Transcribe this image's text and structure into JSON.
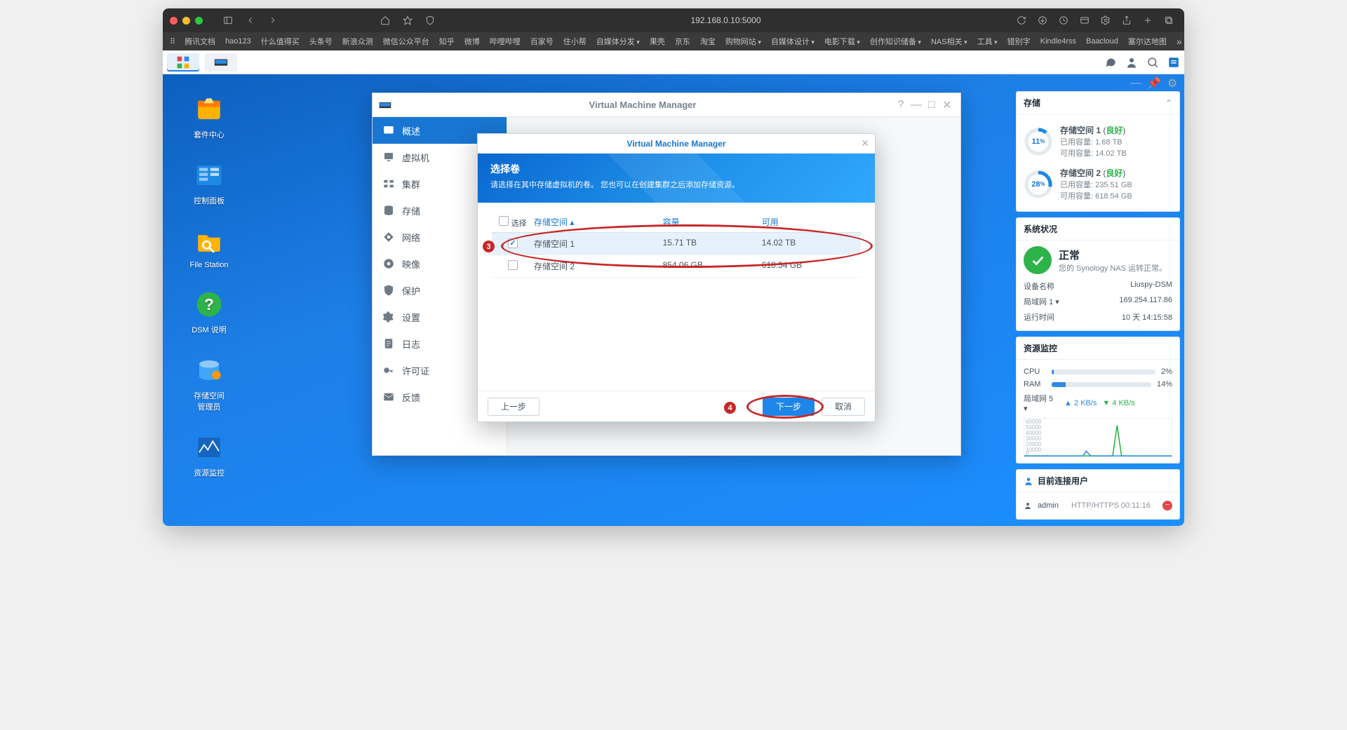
{
  "browser": {
    "address": "192.168.0.10:5000",
    "bookmarks": [
      "腾讯文档",
      "hao123",
      "什么值得买",
      "头条号",
      "新浪众测",
      "微信公众平台",
      "知乎",
      "微博",
      "哔哩哔哩",
      "百家号",
      "住小帮",
      "自媒体分发",
      "果壳",
      "京东",
      "淘宝",
      "购物网站",
      "自媒体设计",
      "电影下载",
      "创作知识储备",
      "NAS相关",
      "工具",
      "错别字",
      "Kindle4rss",
      "Baacloud",
      "塞尔达地图"
    ],
    "bookmark_dropdown_indices": [
      11,
      15,
      16,
      17,
      18,
      19,
      20
    ]
  },
  "desktop_icons": [
    {
      "label": "套件中心",
      "color": "#ff9a00"
    },
    {
      "label": "控制面板",
      "color": "#2b8ae6"
    },
    {
      "label": "File Station",
      "color": "#f7b500"
    },
    {
      "label": "DSM 说明",
      "color": "#1aa33a"
    },
    {
      "label": "存储空间\n管理员",
      "color": "#2b8ae6"
    },
    {
      "label": "资源监控",
      "color": "#245aa6"
    }
  ],
  "widgets": {
    "storage": {
      "title": "存储",
      "volumes": [
        {
          "name": "存储空间 1",
          "status": "良好",
          "used_label": "已用容量: 1.68 TB",
          "avail_label": "可用容量: 14.02 TB",
          "pct": 11
        },
        {
          "name": "存储空间 2",
          "status": "良好",
          "used_label": "已用容量: 235.51 GB",
          "avail_label": "可用容量: 618.54 GB",
          "pct": 28
        }
      ]
    },
    "health": {
      "title": "系统状况",
      "status": "正常",
      "detail": "您的 Synology NAS 运转正常。",
      "rows": [
        [
          "设备名称",
          "Liuspy-DSM"
        ],
        [
          "局域网 1",
          "169.254.117.86"
        ],
        [
          "运行时间",
          "10 天 14:15:58"
        ]
      ]
    },
    "resource": {
      "title": "资源监控",
      "cpu": {
        "label": "CPU",
        "pct": 2
      },
      "ram": {
        "label": "RAM",
        "pct": 14
      },
      "net": {
        "label": "局域网 5",
        "up": "2 KB/s",
        "down": "4 KB/s"
      },
      "ylabels": [
        "60000",
        "50000",
        "40000",
        "30000",
        "20000",
        "10000",
        "0"
      ]
    },
    "users": {
      "title": "目前连接用户",
      "rows": [
        {
          "name": "admin",
          "proto": "HTTP/HTTPS 00:11:16"
        }
      ]
    }
  },
  "vmm": {
    "title": "Virtual Machine Manager",
    "nav": [
      "概述",
      "虚拟机",
      "集群",
      "存储",
      "网络",
      "映像",
      "保护",
      "设置",
      "日志",
      "许可证",
      "反馈"
    ],
    "nav_active": 0
  },
  "wizard": {
    "title": "Virtual Machine Manager",
    "heading": "选择卷",
    "subheading": "请选择在其中存储虚拟机的卷。 您也可以在创建集群之后添加存储资源。",
    "columns": {
      "select": "选择",
      "name": "存储空间 ▴",
      "capacity": "容量",
      "available": "可用"
    },
    "rows": [
      {
        "checked": true,
        "name": "存储空间 1",
        "capacity": "15.71 TB",
        "available": "14.02 TB"
      },
      {
        "checked": false,
        "name": "存储空间 2",
        "capacity": "854.06 GB",
        "available": "618.54 GB"
      }
    ],
    "buttons": {
      "prev": "上一步",
      "next": "下一步",
      "cancel": "取消"
    }
  },
  "annotations": {
    "badge3": "3",
    "badge4": "4"
  }
}
